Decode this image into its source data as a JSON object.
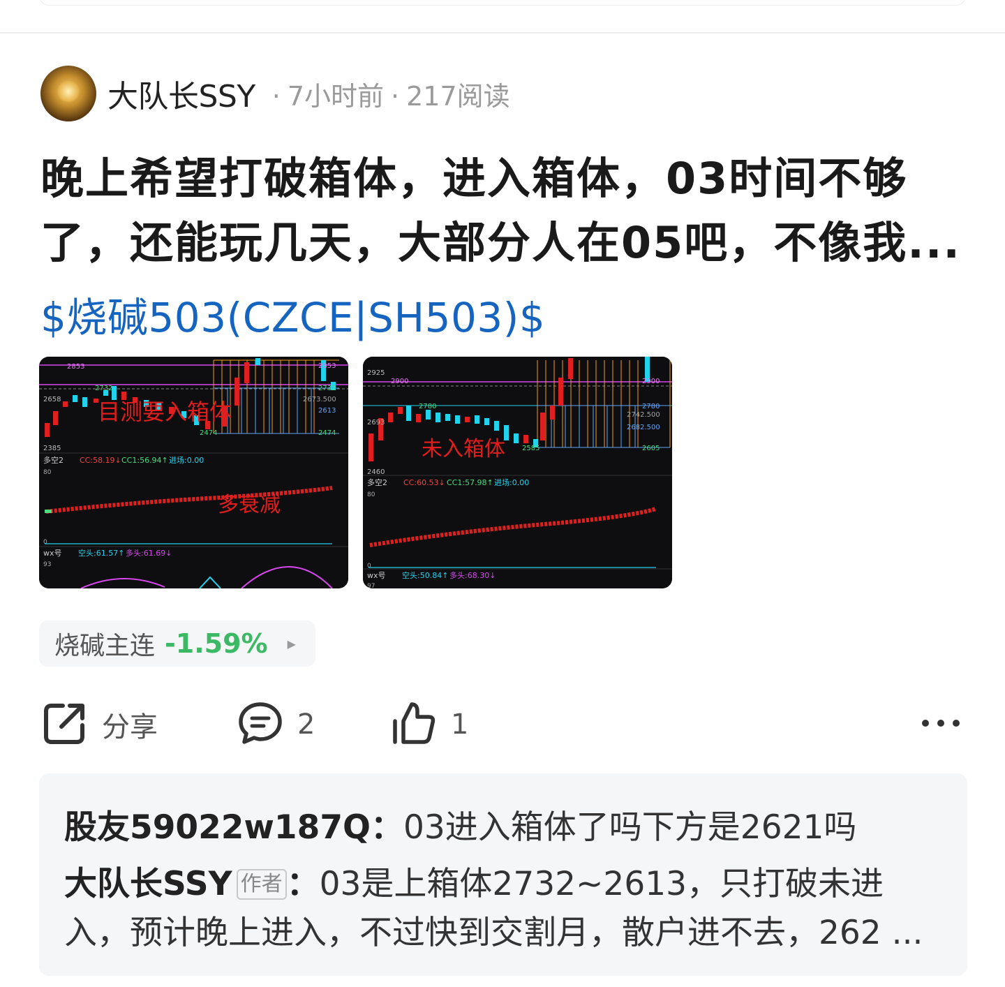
{
  "post": {
    "author": "大队长SSY",
    "time": "7小时前",
    "reads": "217阅读",
    "title_line1": "晚上希望打破箱体，进入箱体，03时间不够",
    "title_line2": "了，还能玩几天，大部分人在05吧，不像我...",
    "stock_tag": "$烧碱503(CZCE|SH503)$"
  },
  "images": [
    {
      "overlay_text": "目测要入箱体",
      "overlay_text2": "多衰减",
      "prices": {
        "p2853": "2853",
        "p2732": "2732",
        "p2658": "2658",
        "p2385": "2385",
        "p2853b": "2853",
        "p2732b": "2732",
        "p2673": "2673.500",
        "p2613": "2613",
        "p2474": "2474",
        "p2474b": "2474"
      },
      "indicator1_name": "多空2",
      "indicator1_values": [
        "CC:58.19↓",
        "CC1:56.94↑",
        "进场:0.00"
      ],
      "indicator1_top": "80",
      "indicator1_bottom": "0",
      "indicator2_name": "wx号",
      "indicator2_values": [
        "空头:61.57↑",
        "多头:61.69↓"
      ],
      "indicator2_top": "93"
    },
    {
      "overlay_text": "未入箱体",
      "prices": {
        "p2925": "2925",
        "p2900": "2900",
        "p2780": "2780",
        "p2693": "2693",
        "p2460": "2460",
        "p2900b": "2900",
        "p2780b": "2780",
        "p2742": "2742.500",
        "p2682": "2682.500",
        "p2605": "2605",
        "p2585": "2585"
      },
      "indicator1_name": "多空2",
      "indicator1_values": [
        "CC:60.53↓",
        "CC1:57.98↑",
        "进场:0.00"
      ],
      "indicator1_top": "80",
      "indicator1_bottom": "0",
      "indicator2_name": "wx号",
      "indicator2_values": [
        "空头:50.84↑",
        "多头:68.30↓"
      ],
      "indicator2_top": "97"
    }
  ],
  "quote": {
    "name": "烧碱主连",
    "change": "-1.59%",
    "change_color": "#3cb964"
  },
  "actions": {
    "share_label": "分享",
    "comment_count": "2",
    "like_count": "1"
  },
  "comments": [
    {
      "user": "股友59022w187Q",
      "sep": "：",
      "text": "03进入箱体了吗下方是2621吗"
    },
    {
      "user": "大队长SSY",
      "tag": "作者",
      "sep": "：",
      "text_line1": "03是上箱体2732~2613，只打破未进",
      "text_line2": "入，预计晚上进入，不过快到交割月，散户进不去，262 ..."
    }
  ],
  "colors": {
    "link": "#1565c0",
    "down": "#3cb964",
    "chart_bg": "#0e0e10",
    "candle_up": "#e02020",
    "candle_down": "#22d3ee"
  }
}
